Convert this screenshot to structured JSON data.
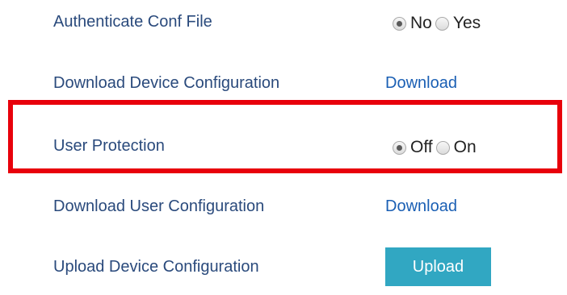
{
  "settings": {
    "authenticate": {
      "label": "Authenticate Conf File",
      "options": [
        "No",
        "Yes"
      ],
      "selected": "No"
    },
    "download_device": {
      "label": "Download Device Configuration",
      "link": "Download"
    },
    "user_protection": {
      "label": "User Protection",
      "options": [
        "Off",
        "On"
      ],
      "selected": "Off"
    },
    "download_user": {
      "label": "Download User Configuration",
      "link": "Download"
    },
    "upload_device": {
      "label": "Upload Device Configuration",
      "button": "Upload"
    }
  },
  "colors": {
    "label": "#2a4a7c",
    "link": "#1a5fb4",
    "upload_button": "#31a7c2",
    "highlight_border": "#e8000b"
  }
}
